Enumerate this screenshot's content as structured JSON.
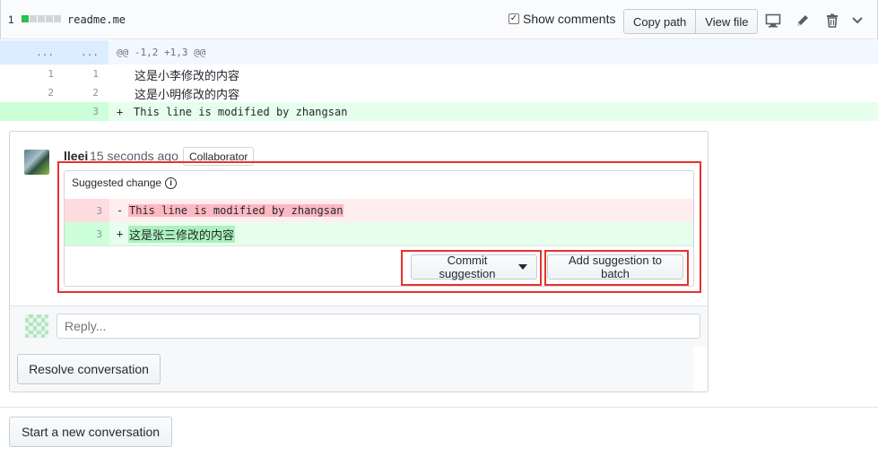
{
  "file_header": {
    "changes_count": "1",
    "filename": "readme.me",
    "show_comments_label": "Show comments",
    "show_comments_checked": true,
    "copy_path_label": "Copy path",
    "view_file_label": "View file",
    "icons": [
      "desktop-icon",
      "pencil-icon",
      "trash-icon",
      "chevron-down-icon"
    ]
  },
  "diff": {
    "hunk_ln_left": "...",
    "hunk_ln_right": "...",
    "hunk_header": "@@ -1,2 +1,3 @@",
    "lines": [
      {
        "old": "1",
        "new": "1",
        "text": "这是小李修改的内容"
      },
      {
        "old": "2",
        "new": "2",
        "text": "这是小明修改的内容"
      }
    ],
    "added_line": {
      "new": "3",
      "sign": "+",
      "text": "This line is modified by zhangsan"
    }
  },
  "comment": {
    "author": "lleei",
    "time": "15 seconds ago",
    "role_badge": "Collaborator",
    "suggestion": {
      "header": "Suggested change",
      "deleted": {
        "ln": "3",
        "sign": "-",
        "text": "This line is modified by zhangsan"
      },
      "added": {
        "ln": "3",
        "sign": "+",
        "text": "这是张三修改的内容"
      }
    },
    "commit_suggestion_label": "Commit suggestion",
    "add_to_batch_label": "Add suggestion to batch"
  },
  "reply": {
    "placeholder": "Reply...",
    "resolve_label": "Resolve conversation"
  },
  "footer": {
    "new_conversation_label": "Start a new conversation"
  },
  "colors": {
    "highlight_box": "#e5332a",
    "add_bg": "#e6ffed",
    "del_bg": "#ffeef0",
    "hunk_bg": "#f1f8ff"
  }
}
